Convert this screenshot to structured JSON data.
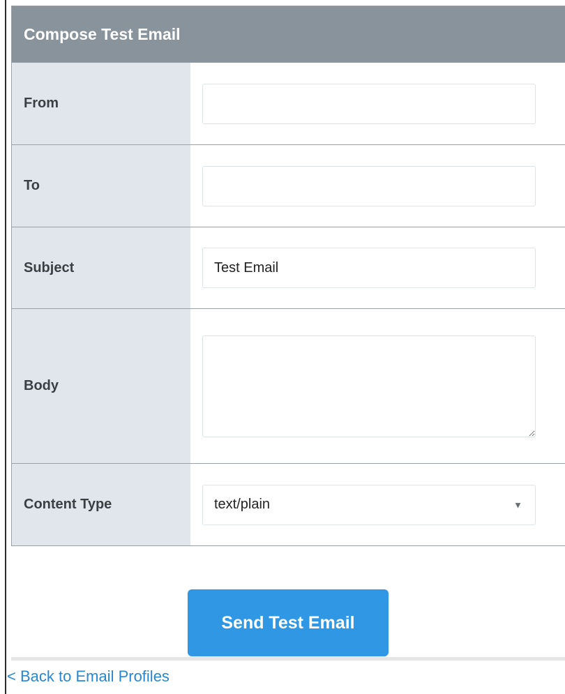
{
  "panel": {
    "title": "Compose Test Email"
  },
  "fields": {
    "from": {
      "label": "From",
      "value": ""
    },
    "to": {
      "label": "To",
      "value": ""
    },
    "subject": {
      "label": "Subject",
      "value": "Test Email"
    },
    "body": {
      "label": "Body",
      "value": ""
    },
    "content_type": {
      "label": "Content Type",
      "selected": "text/plain"
    }
  },
  "actions": {
    "send_label": "Send Test Email",
    "back_label": "< Back to Email Profiles"
  },
  "icons": {
    "select_arrow": "▼"
  },
  "colors": {
    "header_bg": "#88939b",
    "label_bg": "#e1e6ed",
    "button_bg": "#2f97e3",
    "link": "#2a86d1"
  }
}
